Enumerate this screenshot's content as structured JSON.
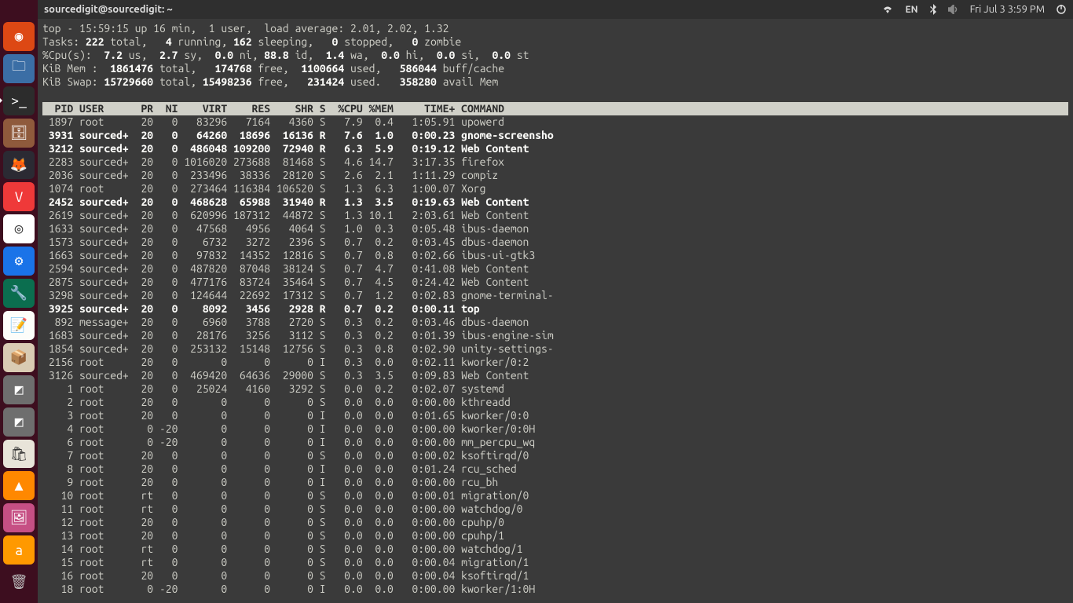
{
  "menubar": {
    "title": "sourcedigit@sourcedigit: ~",
    "lang": "EN",
    "clock": "Fri Jul 3  3:59 PM"
  },
  "launcher": {
    "items": [
      {
        "name": "dash",
        "color": "#dd4814",
        "glyph": "◉"
      },
      {
        "name": "files",
        "color": "#3b6ea5",
        "glyph": "🗀"
      },
      {
        "name": "terminal",
        "color": "#2c2c2c",
        "glyph": ">_",
        "active": true
      },
      {
        "name": "nautilus",
        "color": "#8f5a3c",
        "glyph": "🗄"
      },
      {
        "name": "firefox",
        "color": "#2b2a33",
        "glyph": "🦊"
      },
      {
        "name": "vivaldi",
        "color": "#ef3939",
        "glyph": "V"
      },
      {
        "name": "chrome",
        "color": "#fff",
        "glyph": "◎"
      },
      {
        "name": "settings-blue",
        "color": "#1a73e8",
        "glyph": "⚙"
      },
      {
        "name": "tweak",
        "color": "#0b6e4f",
        "glyph": "🔧"
      },
      {
        "name": "editor",
        "color": "#fdfdfa",
        "glyph": "📝"
      },
      {
        "name": "archiver",
        "color": "#d9cbb3",
        "glyph": "📦"
      },
      {
        "name": "grey1",
        "color": "#6e6e6e",
        "glyph": "◩"
      },
      {
        "name": "grey2",
        "color": "#6e6e6e",
        "glyph": "◩"
      },
      {
        "name": "software",
        "color": "#e8e4d9",
        "glyph": "🛍"
      },
      {
        "name": "vlc",
        "color": "#ff8800",
        "glyph": "▲"
      },
      {
        "name": "image",
        "color": "#c64f84",
        "glyph": "🖼"
      },
      {
        "name": "amazon",
        "color": "#ff9900",
        "glyph": "a"
      }
    ]
  },
  "top": {
    "summary": [
      {
        "segments": [
          {
            "t": "top - 15:59:15 up 16 min,  1 user,  load average: 2.01, 2.02, 1.32"
          }
        ]
      },
      {
        "segments": [
          {
            "t": "Tasks: "
          },
          {
            "t": "222",
            "b": true
          },
          {
            "t": " total,   "
          },
          {
            "t": "4",
            "b": true
          },
          {
            "t": " running, "
          },
          {
            "t": "162",
            "b": true
          },
          {
            "t": " sleeping,   "
          },
          {
            "t": "0",
            "b": true
          },
          {
            "t": " stopped,   "
          },
          {
            "t": "0",
            "b": true
          },
          {
            "t": " zombie"
          }
        ]
      },
      {
        "segments": [
          {
            "t": "%Cpu(s):  "
          },
          {
            "t": "7.2",
            "b": true
          },
          {
            "t": " us,  "
          },
          {
            "t": "2.7",
            "b": true
          },
          {
            "t": " sy,  "
          },
          {
            "t": "0.0",
            "b": true
          },
          {
            "t": " ni, "
          },
          {
            "t": "88.8",
            "b": true
          },
          {
            "t": " id,  "
          },
          {
            "t": "1.4",
            "b": true
          },
          {
            "t": " wa,  "
          },
          {
            "t": "0.0",
            "b": true
          },
          {
            "t": " hi,  "
          },
          {
            "t": "0.0",
            "b": true
          },
          {
            "t": " si,  "
          },
          {
            "t": "0.0",
            "b": true
          },
          {
            "t": " st"
          }
        ]
      },
      {
        "segments": [
          {
            "t": "KiB Mem :  "
          },
          {
            "t": "1861476",
            "b": true
          },
          {
            "t": " total,   "
          },
          {
            "t": "174768",
            "b": true
          },
          {
            "t": " free,  "
          },
          {
            "t": "1100664",
            "b": true
          },
          {
            "t": " used,   "
          },
          {
            "t": "586044",
            "b": true
          },
          {
            "t": " buff/cache"
          }
        ]
      },
      {
        "segments": [
          {
            "t": "KiB Swap: "
          },
          {
            "t": "15729660",
            "b": true
          },
          {
            "t": " total, "
          },
          {
            "t": "15498236",
            "b": true
          },
          {
            "t": " free,   "
          },
          {
            "t": "231424",
            "b": true
          },
          {
            "t": " used.   "
          },
          {
            "t": "358280",
            "b": true
          },
          {
            "t": " avail Mem"
          }
        ]
      }
    ],
    "columns": "  PID USER      PR  NI    VIRT    RES    SHR S  %CPU %MEM     TIME+ COMMAND                                                                          ",
    "processes": [
      {
        "pid": 1897,
        "user": "root",
        "pr": "20",
        "ni": "0",
        "virt": "83296",
        "res": "7164",
        "shr": "4360",
        "s": "S",
        "cpu": "7.9",
        "mem": "0.4",
        "time": "1:05.91",
        "cmd": "upowerd",
        "bold": false
      },
      {
        "pid": 3931,
        "user": "sourced+",
        "pr": "20",
        "ni": "0",
        "virt": "64260",
        "res": "18696",
        "shr": "16136",
        "s": "R",
        "cpu": "7.6",
        "mem": "1.0",
        "time": "0:00.23",
        "cmd": "gnome-screensho",
        "bold": true
      },
      {
        "pid": 3212,
        "user": "sourced+",
        "pr": "20",
        "ni": "0",
        "virt": "486048",
        "res": "109200",
        "shr": "72940",
        "s": "R",
        "cpu": "6.3",
        "mem": "5.9",
        "time": "0:19.12",
        "cmd": "Web Content",
        "bold": true
      },
      {
        "pid": 2283,
        "user": "sourced+",
        "pr": "20",
        "ni": "0",
        "virt": "1016020",
        "res": "273688",
        "shr": "81468",
        "s": "S",
        "cpu": "4.6",
        "mem": "14.7",
        "time": "3:17.35",
        "cmd": "firefox",
        "bold": false
      },
      {
        "pid": 2036,
        "user": "sourced+",
        "pr": "20",
        "ni": "0",
        "virt": "233496",
        "res": "38336",
        "shr": "28120",
        "s": "S",
        "cpu": "2.6",
        "mem": "2.1",
        "time": "1:11.29",
        "cmd": "compiz",
        "bold": false
      },
      {
        "pid": 1074,
        "user": "root",
        "pr": "20",
        "ni": "0",
        "virt": "273464",
        "res": "116384",
        "shr": "106520",
        "s": "S",
        "cpu": "1.3",
        "mem": "6.3",
        "time": "1:00.07",
        "cmd": "Xorg",
        "bold": false
      },
      {
        "pid": 2452,
        "user": "sourced+",
        "pr": "20",
        "ni": "0",
        "virt": "468628",
        "res": "65988",
        "shr": "31940",
        "s": "R",
        "cpu": "1.3",
        "mem": "3.5",
        "time": "0:19.63",
        "cmd": "Web Content",
        "bold": true
      },
      {
        "pid": 2619,
        "user": "sourced+",
        "pr": "20",
        "ni": "0",
        "virt": "620996",
        "res": "187312",
        "shr": "44872",
        "s": "S",
        "cpu": "1.3",
        "mem": "10.1",
        "time": "2:03.61",
        "cmd": "Web Content",
        "bold": false
      },
      {
        "pid": 1633,
        "user": "sourced+",
        "pr": "20",
        "ni": "0",
        "virt": "47568",
        "res": "4956",
        "shr": "4064",
        "s": "S",
        "cpu": "1.0",
        "mem": "0.3",
        "time": "0:05.48",
        "cmd": "ibus-daemon",
        "bold": false
      },
      {
        "pid": 1573,
        "user": "sourced+",
        "pr": "20",
        "ni": "0",
        "virt": "6732",
        "res": "3272",
        "shr": "2396",
        "s": "S",
        "cpu": "0.7",
        "mem": "0.2",
        "time": "0:03.45",
        "cmd": "dbus-daemon",
        "bold": false
      },
      {
        "pid": 1663,
        "user": "sourced+",
        "pr": "20",
        "ni": "0",
        "virt": "97832",
        "res": "14352",
        "shr": "12816",
        "s": "S",
        "cpu": "0.7",
        "mem": "0.8",
        "time": "0:02.66",
        "cmd": "ibus-ui-gtk3",
        "bold": false
      },
      {
        "pid": 2594,
        "user": "sourced+",
        "pr": "20",
        "ni": "0",
        "virt": "487820",
        "res": "87048",
        "shr": "38124",
        "s": "S",
        "cpu": "0.7",
        "mem": "4.7",
        "time": "0:41.08",
        "cmd": "Web Content",
        "bold": false
      },
      {
        "pid": 2875,
        "user": "sourced+",
        "pr": "20",
        "ni": "0",
        "virt": "477176",
        "res": "83724",
        "shr": "35464",
        "s": "S",
        "cpu": "0.7",
        "mem": "4.5",
        "time": "0:24.42",
        "cmd": "Web Content",
        "bold": false
      },
      {
        "pid": 3298,
        "user": "sourced+",
        "pr": "20",
        "ni": "0",
        "virt": "124644",
        "res": "22692",
        "shr": "17312",
        "s": "S",
        "cpu": "0.7",
        "mem": "1.2",
        "time": "0:02.83",
        "cmd": "gnome-terminal-",
        "bold": false
      },
      {
        "pid": 3925,
        "user": "sourced+",
        "pr": "20",
        "ni": "0",
        "virt": "8092",
        "res": "3456",
        "shr": "2928",
        "s": "R",
        "cpu": "0.7",
        "mem": "0.2",
        "time": "0:00.11",
        "cmd": "top",
        "bold": true
      },
      {
        "pid": 892,
        "user": "message+",
        "pr": "20",
        "ni": "0",
        "virt": "6960",
        "res": "3788",
        "shr": "2720",
        "s": "S",
        "cpu": "0.3",
        "mem": "0.2",
        "time": "0:03.46",
        "cmd": "dbus-daemon",
        "bold": false
      },
      {
        "pid": 1683,
        "user": "sourced+",
        "pr": "20",
        "ni": "0",
        "virt": "28176",
        "res": "3256",
        "shr": "3112",
        "s": "S",
        "cpu": "0.3",
        "mem": "0.2",
        "time": "0:01.39",
        "cmd": "ibus-engine-sim",
        "bold": false
      },
      {
        "pid": 1854,
        "user": "sourced+",
        "pr": "20",
        "ni": "0",
        "virt": "253132",
        "res": "15148",
        "shr": "12756",
        "s": "S",
        "cpu": "0.3",
        "mem": "0.8",
        "time": "0:02.90",
        "cmd": "unity-settings-",
        "bold": false
      },
      {
        "pid": 2156,
        "user": "root",
        "pr": "20",
        "ni": "0",
        "virt": "0",
        "res": "0",
        "shr": "0",
        "s": "I",
        "cpu": "0.3",
        "mem": "0.0",
        "time": "0:02.11",
        "cmd": "kworker/0:2",
        "bold": false
      },
      {
        "pid": 3126,
        "user": "sourced+",
        "pr": "20",
        "ni": "0",
        "virt": "469420",
        "res": "64636",
        "shr": "29000",
        "s": "S",
        "cpu": "0.3",
        "mem": "3.5",
        "time": "0:09.83",
        "cmd": "Web Content",
        "bold": false
      },
      {
        "pid": 1,
        "user": "root",
        "pr": "20",
        "ni": "0",
        "virt": "25024",
        "res": "4160",
        "shr": "3292",
        "s": "S",
        "cpu": "0.0",
        "mem": "0.2",
        "time": "0:02.07",
        "cmd": "systemd",
        "bold": false
      },
      {
        "pid": 2,
        "user": "root",
        "pr": "20",
        "ni": "0",
        "virt": "0",
        "res": "0",
        "shr": "0",
        "s": "S",
        "cpu": "0.0",
        "mem": "0.0",
        "time": "0:00.00",
        "cmd": "kthreadd",
        "bold": false
      },
      {
        "pid": 3,
        "user": "root",
        "pr": "20",
        "ni": "0",
        "virt": "0",
        "res": "0",
        "shr": "0",
        "s": "I",
        "cpu": "0.0",
        "mem": "0.0",
        "time": "0:01.65",
        "cmd": "kworker/0:0",
        "bold": false
      },
      {
        "pid": 4,
        "user": "root",
        "pr": "0",
        "ni": "-20",
        "virt": "0",
        "res": "0",
        "shr": "0",
        "s": "I",
        "cpu": "0.0",
        "mem": "0.0",
        "time": "0:00.00",
        "cmd": "kworker/0:0H",
        "bold": false
      },
      {
        "pid": 6,
        "user": "root",
        "pr": "0",
        "ni": "-20",
        "virt": "0",
        "res": "0",
        "shr": "0",
        "s": "I",
        "cpu": "0.0",
        "mem": "0.0",
        "time": "0:00.00",
        "cmd": "mm_percpu_wq",
        "bold": false
      },
      {
        "pid": 7,
        "user": "root",
        "pr": "20",
        "ni": "0",
        "virt": "0",
        "res": "0",
        "shr": "0",
        "s": "S",
        "cpu": "0.0",
        "mem": "0.0",
        "time": "0:00.02",
        "cmd": "ksoftirqd/0",
        "bold": false
      },
      {
        "pid": 8,
        "user": "root",
        "pr": "20",
        "ni": "0",
        "virt": "0",
        "res": "0",
        "shr": "0",
        "s": "I",
        "cpu": "0.0",
        "mem": "0.0",
        "time": "0:01.24",
        "cmd": "rcu_sched",
        "bold": false
      },
      {
        "pid": 9,
        "user": "root",
        "pr": "20",
        "ni": "0",
        "virt": "0",
        "res": "0",
        "shr": "0",
        "s": "I",
        "cpu": "0.0",
        "mem": "0.0",
        "time": "0:00.00",
        "cmd": "rcu_bh",
        "bold": false
      },
      {
        "pid": 10,
        "user": "root",
        "pr": "rt",
        "ni": "0",
        "virt": "0",
        "res": "0",
        "shr": "0",
        "s": "S",
        "cpu": "0.0",
        "mem": "0.0",
        "time": "0:00.01",
        "cmd": "migration/0",
        "bold": false
      },
      {
        "pid": 11,
        "user": "root",
        "pr": "rt",
        "ni": "0",
        "virt": "0",
        "res": "0",
        "shr": "0",
        "s": "S",
        "cpu": "0.0",
        "mem": "0.0",
        "time": "0:00.00",
        "cmd": "watchdog/0",
        "bold": false
      },
      {
        "pid": 12,
        "user": "root",
        "pr": "20",
        "ni": "0",
        "virt": "0",
        "res": "0",
        "shr": "0",
        "s": "S",
        "cpu": "0.0",
        "mem": "0.0",
        "time": "0:00.00",
        "cmd": "cpuhp/0",
        "bold": false
      },
      {
        "pid": 13,
        "user": "root",
        "pr": "20",
        "ni": "0",
        "virt": "0",
        "res": "0",
        "shr": "0",
        "s": "S",
        "cpu": "0.0",
        "mem": "0.0",
        "time": "0:00.00",
        "cmd": "cpuhp/1",
        "bold": false
      },
      {
        "pid": 14,
        "user": "root",
        "pr": "rt",
        "ni": "0",
        "virt": "0",
        "res": "0",
        "shr": "0",
        "s": "S",
        "cpu": "0.0",
        "mem": "0.0",
        "time": "0:00.00",
        "cmd": "watchdog/1",
        "bold": false
      },
      {
        "pid": 15,
        "user": "root",
        "pr": "rt",
        "ni": "0",
        "virt": "0",
        "res": "0",
        "shr": "0",
        "s": "S",
        "cpu": "0.0",
        "mem": "0.0",
        "time": "0:00.04",
        "cmd": "migration/1",
        "bold": false
      },
      {
        "pid": 16,
        "user": "root",
        "pr": "20",
        "ni": "0",
        "virt": "0",
        "res": "0",
        "shr": "0",
        "s": "S",
        "cpu": "0.0",
        "mem": "0.0",
        "time": "0:00.04",
        "cmd": "ksoftirqd/1",
        "bold": false
      },
      {
        "pid": 18,
        "user": "root",
        "pr": "0",
        "ni": "-20",
        "virt": "0",
        "res": "0",
        "shr": "0",
        "s": "I",
        "cpu": "0.0",
        "mem": "0.0",
        "time": "0:00.00",
        "cmd": "kworker/1:0H",
        "bold": false
      }
    ]
  }
}
